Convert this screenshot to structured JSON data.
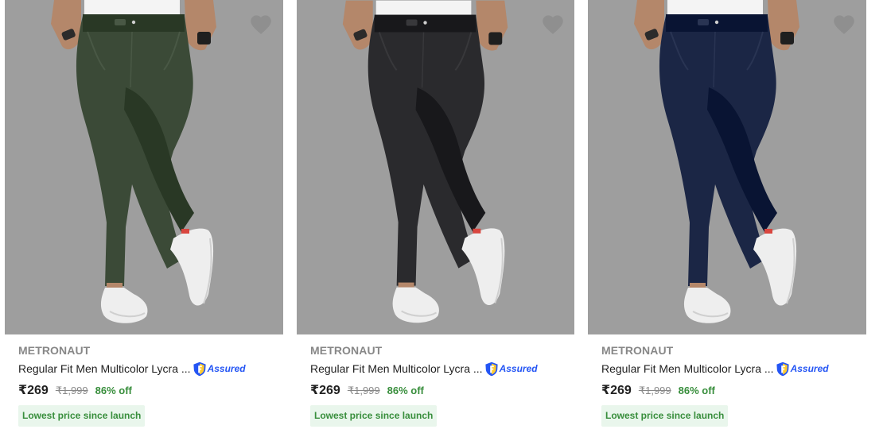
{
  "products": [
    {
      "brand": "METRONAUT",
      "title": "Regular Fit Men Multicolor Lycra ...",
      "assured_label": "Assured",
      "price": "₹269",
      "mrp": "₹1,999",
      "discount": "86% off",
      "badge": "Lowest price since launch",
      "pant_color": "#3b4a37",
      "image_bg": "#9e9e9e"
    },
    {
      "brand": "METRONAUT",
      "title": "Regular Fit Men Multicolor Lycra ...",
      "assured_label": "Assured",
      "price": "₹269",
      "mrp": "₹1,999",
      "discount": "86% off",
      "badge": "Lowest price since launch",
      "pant_color": "#2a2a2d",
      "image_bg": "#9e9e9e"
    },
    {
      "brand": "METRONAUT",
      "title": "Regular Fit Men Multicolor Lycra ...",
      "assured_label": "Assured",
      "price": "₹269",
      "mrp": "₹1,999",
      "discount": "86% off",
      "badge": "Lowest price since launch",
      "pant_color": "#1b2645",
      "image_bg": "#9e9e9e"
    }
  ],
  "icons": {
    "wishlist": "heart-icon",
    "assured": "flipkart-assured-icon"
  },
  "colors": {
    "discount_green": "#388e3c",
    "badge_bg": "#e9f6ec",
    "brand_gray": "#878787",
    "assured_blue": "#2455f4",
    "wishlist_gray": "#8f8f8f"
  }
}
